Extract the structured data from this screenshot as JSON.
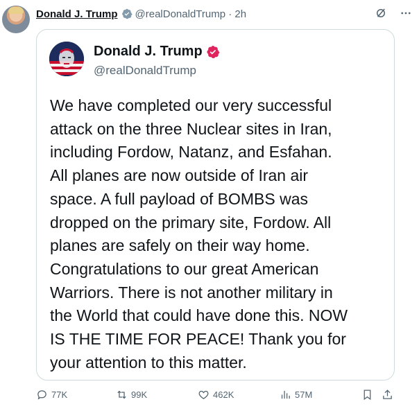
{
  "post": {
    "author_name": "Donald J. Trump",
    "meta": "@realDonaldTrump · 2h"
  },
  "quoted": {
    "name": "Donald J. Trump",
    "handle": "@realDonaldTrump",
    "lines": [
      "We have completed our very successful",
      "attack on the three Nuclear sites in Iran,",
      "including Fordow, Natanz, and Esfahan.",
      "All planes are now outside of Iran air",
      "space. A full payload of BOMBS was",
      "dropped on the primary site, Fordow. All",
      "planes are safely on their way home.",
      "Congratulations to our great American",
      "Warriors. There is not another military in",
      "the World that could have done this. NOW",
      "IS THE TIME FOR PEACE! Thank you for",
      "your attention to this matter."
    ]
  },
  "actions": {
    "replies": "77K",
    "reposts": "99K",
    "likes": "462K",
    "views": "57M"
  },
  "colors": {
    "verified_badge": "#e0245e",
    "secondary_text": "#536471"
  }
}
